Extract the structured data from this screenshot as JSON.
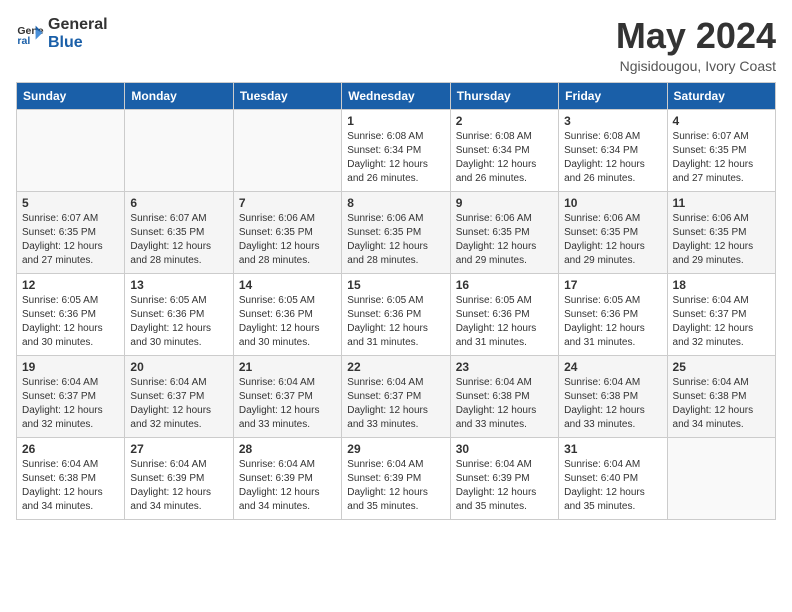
{
  "logo": {
    "line1": "General",
    "line2": "Blue"
  },
  "title": "May 2024",
  "location": "Ngisidougou, Ivory Coast",
  "days_header": [
    "Sunday",
    "Monday",
    "Tuesday",
    "Wednesday",
    "Thursday",
    "Friday",
    "Saturday"
  ],
  "weeks": [
    [
      {
        "day": "",
        "info": ""
      },
      {
        "day": "",
        "info": ""
      },
      {
        "day": "",
        "info": ""
      },
      {
        "day": "1",
        "info": "Sunrise: 6:08 AM\nSunset: 6:34 PM\nDaylight: 12 hours\nand 26 minutes."
      },
      {
        "day": "2",
        "info": "Sunrise: 6:08 AM\nSunset: 6:34 PM\nDaylight: 12 hours\nand 26 minutes."
      },
      {
        "day": "3",
        "info": "Sunrise: 6:08 AM\nSunset: 6:34 PM\nDaylight: 12 hours\nand 26 minutes."
      },
      {
        "day": "4",
        "info": "Sunrise: 6:07 AM\nSunset: 6:35 PM\nDaylight: 12 hours\nand 27 minutes."
      }
    ],
    [
      {
        "day": "5",
        "info": "Sunrise: 6:07 AM\nSunset: 6:35 PM\nDaylight: 12 hours\nand 27 minutes."
      },
      {
        "day": "6",
        "info": "Sunrise: 6:07 AM\nSunset: 6:35 PM\nDaylight: 12 hours\nand 28 minutes."
      },
      {
        "day": "7",
        "info": "Sunrise: 6:06 AM\nSunset: 6:35 PM\nDaylight: 12 hours\nand 28 minutes."
      },
      {
        "day": "8",
        "info": "Sunrise: 6:06 AM\nSunset: 6:35 PM\nDaylight: 12 hours\nand 28 minutes."
      },
      {
        "day": "9",
        "info": "Sunrise: 6:06 AM\nSunset: 6:35 PM\nDaylight: 12 hours\nand 29 minutes."
      },
      {
        "day": "10",
        "info": "Sunrise: 6:06 AM\nSunset: 6:35 PM\nDaylight: 12 hours\nand 29 minutes."
      },
      {
        "day": "11",
        "info": "Sunrise: 6:06 AM\nSunset: 6:35 PM\nDaylight: 12 hours\nand 29 minutes."
      }
    ],
    [
      {
        "day": "12",
        "info": "Sunrise: 6:05 AM\nSunset: 6:36 PM\nDaylight: 12 hours\nand 30 minutes."
      },
      {
        "day": "13",
        "info": "Sunrise: 6:05 AM\nSunset: 6:36 PM\nDaylight: 12 hours\nand 30 minutes."
      },
      {
        "day": "14",
        "info": "Sunrise: 6:05 AM\nSunset: 6:36 PM\nDaylight: 12 hours\nand 30 minutes."
      },
      {
        "day": "15",
        "info": "Sunrise: 6:05 AM\nSunset: 6:36 PM\nDaylight: 12 hours\nand 31 minutes."
      },
      {
        "day": "16",
        "info": "Sunrise: 6:05 AM\nSunset: 6:36 PM\nDaylight: 12 hours\nand 31 minutes."
      },
      {
        "day": "17",
        "info": "Sunrise: 6:05 AM\nSunset: 6:36 PM\nDaylight: 12 hours\nand 31 minutes."
      },
      {
        "day": "18",
        "info": "Sunrise: 6:04 AM\nSunset: 6:37 PM\nDaylight: 12 hours\nand 32 minutes."
      }
    ],
    [
      {
        "day": "19",
        "info": "Sunrise: 6:04 AM\nSunset: 6:37 PM\nDaylight: 12 hours\nand 32 minutes."
      },
      {
        "day": "20",
        "info": "Sunrise: 6:04 AM\nSunset: 6:37 PM\nDaylight: 12 hours\nand 32 minutes."
      },
      {
        "day": "21",
        "info": "Sunrise: 6:04 AM\nSunset: 6:37 PM\nDaylight: 12 hours\nand 33 minutes."
      },
      {
        "day": "22",
        "info": "Sunrise: 6:04 AM\nSunset: 6:37 PM\nDaylight: 12 hours\nand 33 minutes."
      },
      {
        "day": "23",
        "info": "Sunrise: 6:04 AM\nSunset: 6:38 PM\nDaylight: 12 hours\nand 33 minutes."
      },
      {
        "day": "24",
        "info": "Sunrise: 6:04 AM\nSunset: 6:38 PM\nDaylight: 12 hours\nand 33 minutes."
      },
      {
        "day": "25",
        "info": "Sunrise: 6:04 AM\nSunset: 6:38 PM\nDaylight: 12 hours\nand 34 minutes."
      }
    ],
    [
      {
        "day": "26",
        "info": "Sunrise: 6:04 AM\nSunset: 6:38 PM\nDaylight: 12 hours\nand 34 minutes."
      },
      {
        "day": "27",
        "info": "Sunrise: 6:04 AM\nSunset: 6:39 PM\nDaylight: 12 hours\nand 34 minutes."
      },
      {
        "day": "28",
        "info": "Sunrise: 6:04 AM\nSunset: 6:39 PM\nDaylight: 12 hours\nand 34 minutes."
      },
      {
        "day": "29",
        "info": "Sunrise: 6:04 AM\nSunset: 6:39 PM\nDaylight: 12 hours\nand 35 minutes."
      },
      {
        "day": "30",
        "info": "Sunrise: 6:04 AM\nSunset: 6:39 PM\nDaylight: 12 hours\nand 35 minutes."
      },
      {
        "day": "31",
        "info": "Sunrise: 6:04 AM\nSunset: 6:40 PM\nDaylight: 12 hours\nand 35 minutes."
      },
      {
        "day": "",
        "info": ""
      }
    ]
  ]
}
